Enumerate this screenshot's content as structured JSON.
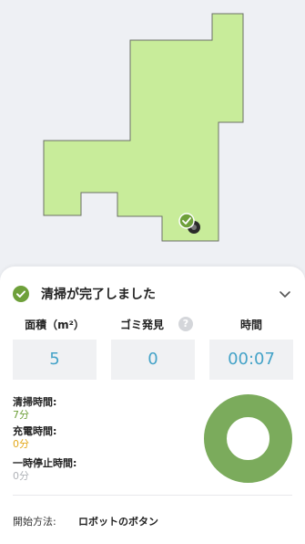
{
  "map": {
    "floor_color": "#c8ec9a",
    "outline_color": "#6b6f66",
    "robot_icon": "robot-icon",
    "dock_icon": "dock-check-icon"
  },
  "summary": {
    "status_text": "清掃が完了しました",
    "status_icon": "check-circle-icon",
    "collapse_icon": "chevron-down-icon",
    "accent_color": "#6ea03a"
  },
  "stats": [
    {
      "label": "面積（m²）",
      "value": "5"
    },
    {
      "label": "ゴミ発見",
      "value": "0",
      "help": "?"
    },
    {
      "label": "時間",
      "value": "00:07"
    }
  ],
  "details": [
    {
      "label": "清掃時間:",
      "value": "7分",
      "color": "#6ea03a"
    },
    {
      "label": "充電時間:",
      "value": "0分",
      "color": "#e3a81a"
    },
    {
      "label": "一時停止時間:",
      "value": "0分",
      "color": "#b0b3b8"
    }
  ],
  "donut": {
    "cleaning_fraction": 1.0,
    "color": "#7bab5c"
  },
  "start": {
    "label": "開始方法:",
    "value": "ロボットのボタン"
  }
}
